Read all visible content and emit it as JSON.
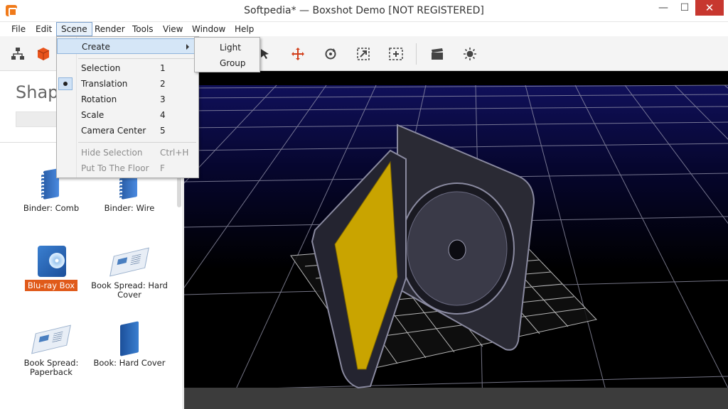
{
  "window": {
    "title": "Softpedia* — Boxshot Demo [NOT REGISTERED]",
    "min_glyph": "—",
    "max_glyph": "☐",
    "close_glyph": "✕"
  },
  "menubar": [
    {
      "label": "File"
    },
    {
      "label": "Edit"
    },
    {
      "label": "Scene",
      "active": true
    },
    {
      "label": "Render"
    },
    {
      "label": "Tools"
    },
    {
      "label": "View"
    },
    {
      "label": "Window"
    },
    {
      "label": "Help"
    }
  ],
  "toolbar": {
    "icons": [
      "hierarchy-icon",
      "shape-cube-icon",
      "select-arrow-icon",
      "move-icon",
      "rotate-icon",
      "scale-icon",
      "camera-center-icon",
      "clapper-render-icon",
      "light-icon"
    ]
  },
  "left_panel": {
    "heading": "Shap",
    "items": [
      {
        "label": "Binder: Comb",
        "icon": "binder-comb-icon"
      },
      {
        "label": "Binder: Wire",
        "icon": "binder-wire-icon"
      },
      {
        "label": "Blu-ray Box",
        "icon": "bluray-box-icon",
        "selected": true
      },
      {
        "label": "Book Spread: Hard Cover",
        "icon": "book-spread-hard-icon"
      },
      {
        "label": "Book Spread: Paperback",
        "icon": "book-spread-paperback-icon"
      },
      {
        "label": "Book: Hard Cover",
        "icon": "book-hard-cover-icon"
      }
    ]
  },
  "scene_menu": {
    "create": "Create",
    "items": [
      {
        "label": "Selection",
        "key": "1"
      },
      {
        "label": "Translation",
        "key": "2",
        "checked": true
      },
      {
        "label": "Rotation",
        "key": "3"
      },
      {
        "label": "Scale",
        "key": "4"
      },
      {
        "label": "Camera Center",
        "key": "5"
      }
    ],
    "disabled_items": [
      {
        "label": "Hide Selection",
        "key": "Ctrl+H"
      },
      {
        "label": "Put To The Floor",
        "key": "F"
      }
    ]
  },
  "create_submenu": [
    "Light",
    "Group"
  ],
  "colors": {
    "accent_selected": "#e05a1a",
    "menu_highlight": "#d5e6f7",
    "case_yellow": "#c9a400",
    "viewport_sky": "#0b0b3a"
  }
}
